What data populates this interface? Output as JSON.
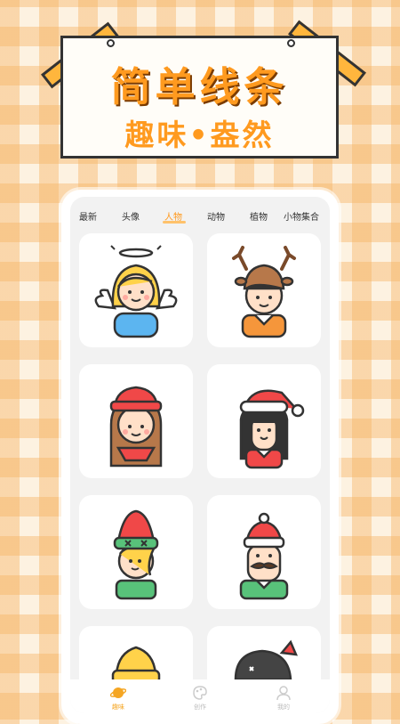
{
  "banner": {
    "title": "简单线条",
    "subtitle": "趣味•盎然"
  },
  "tabs": [
    {
      "label": "最新",
      "active": false
    },
    {
      "label": "头像",
      "active": false
    },
    {
      "label": "人物",
      "active": true
    },
    {
      "label": "动物",
      "active": false
    },
    {
      "label": "植物",
      "active": false
    },
    {
      "label": "小物集合",
      "active": false
    }
  ],
  "gallery": [
    {
      "icon": "angel-girl-icon"
    },
    {
      "icon": "reindeer-hat-boy-icon"
    },
    {
      "icon": "winter-hat-girl-icon"
    },
    {
      "icon": "santa-hat-girl-icon"
    },
    {
      "icon": "elf-girl-icon"
    },
    {
      "icon": "mustache-man-icon"
    },
    {
      "icon": "beanie-partial-icon"
    },
    {
      "icon": "dark-hat-partial-icon"
    }
  ],
  "bottom_nav": [
    {
      "label": "趣味",
      "icon": "planet-icon",
      "active": true
    },
    {
      "label": "创作",
      "icon": "palette-icon",
      "active": false
    },
    {
      "label": "我的",
      "icon": "user-icon",
      "active": false
    }
  ],
  "colors": {
    "accent": "#ff9a1f",
    "tape": "#ffb63d",
    "gingham": "#f5b260"
  }
}
